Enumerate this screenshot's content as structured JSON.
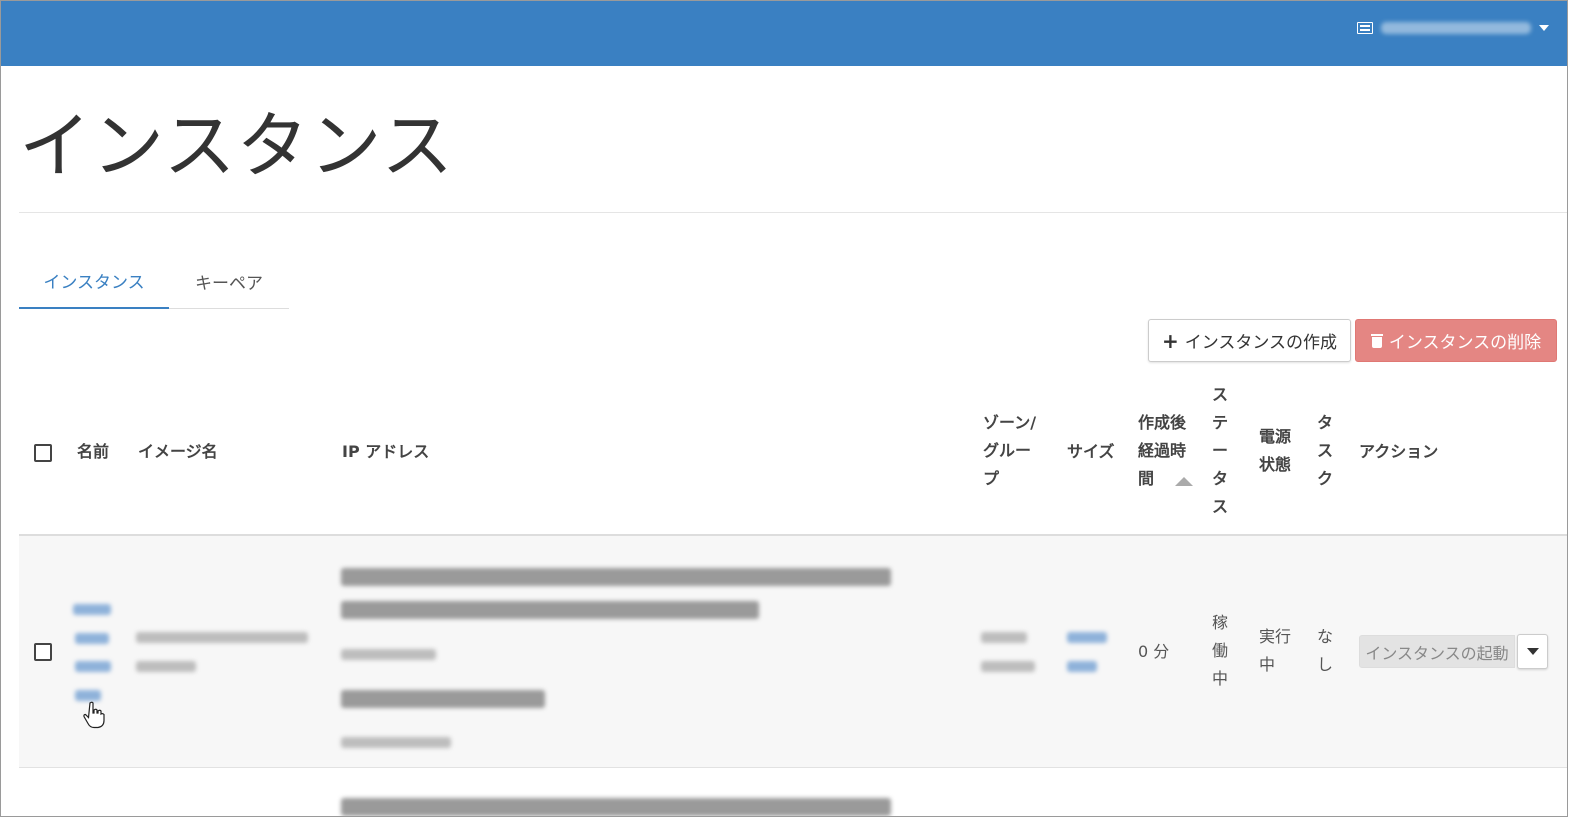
{
  "page": {
    "title": "インスタンス"
  },
  "header": {
    "user_icon": "list-icon",
    "dropdown_icon": "caret-down-icon",
    "topbar_color": "#3a80c2"
  },
  "tabs": [
    {
      "label": "インスタンス",
      "active": true
    },
    {
      "label": "キーペア",
      "active": false
    }
  ],
  "toolbar": {
    "create_label": "インスタンスの作成",
    "create_icon": "plus-icon",
    "delete_label": "インスタンスの削除",
    "delete_icon": "trash-icon",
    "delete_color": "#d9534f"
  },
  "table": {
    "columns": {
      "name": "名前",
      "image": "イメージ名",
      "ip": "IP アドレス",
      "zone": [
        "ゾーン/",
        "グルー",
        "プ"
      ],
      "size": "サイズ",
      "age": [
        "作成後",
        "経過時",
        "間"
      ],
      "status": [
        "ス",
        "テ",
        "ー",
        "タ",
        "ス"
      ],
      "power": [
        "電源",
        "状態"
      ],
      "task": [
        "タ",
        "ス",
        "ク"
      ],
      "actions": "アクション"
    },
    "rows": [
      {
        "age": "0 分",
        "status": [
          "稼",
          "働",
          "中"
        ],
        "power": [
          "実行",
          "中"
        ],
        "task": [
          "な",
          "し"
        ],
        "action_label": "インスタンスの起動"
      }
    ]
  }
}
